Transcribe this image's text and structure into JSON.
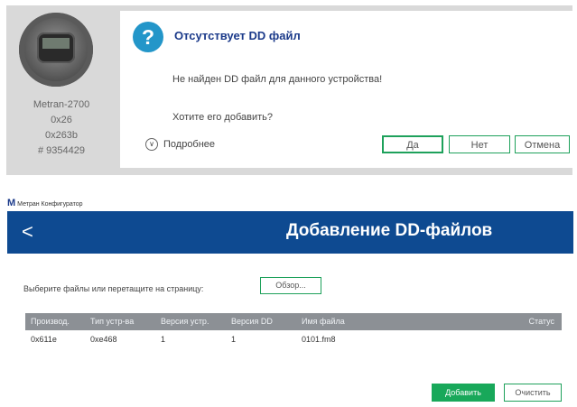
{
  "dialog": {
    "device": {
      "name": "Metran-2700",
      "code1": "0x26",
      "code2": "0x263b",
      "serial": "# 9354429"
    },
    "title": "Отсутствует DD файл",
    "message": "Не найден DD файл для данного устройства!",
    "question": "Хотите его добавить?",
    "details_label": "Подробнее",
    "buttons": {
      "yes": "Да",
      "no": "Нет",
      "cancel": "Отмена"
    }
  },
  "app": {
    "logo": "M",
    "title": "Метран Конфигуратор",
    "header": {
      "back": "<",
      "title": "Добавление DD-файлов"
    },
    "select_label": "Выберите файлы или перетащите на страницу:",
    "browse_label": "Обзор...",
    "table": {
      "columns": [
        "Производ.",
        "Тип устр-ва",
        "Версия устр.",
        "Версия DD",
        "Имя файла",
        "Статус"
      ],
      "rows": [
        [
          "0x611e",
          "0xe468",
          "1",
          "1",
          "0101.fm8",
          ""
        ]
      ]
    },
    "add_label": "Добавить",
    "clear_label": "Очистить"
  }
}
